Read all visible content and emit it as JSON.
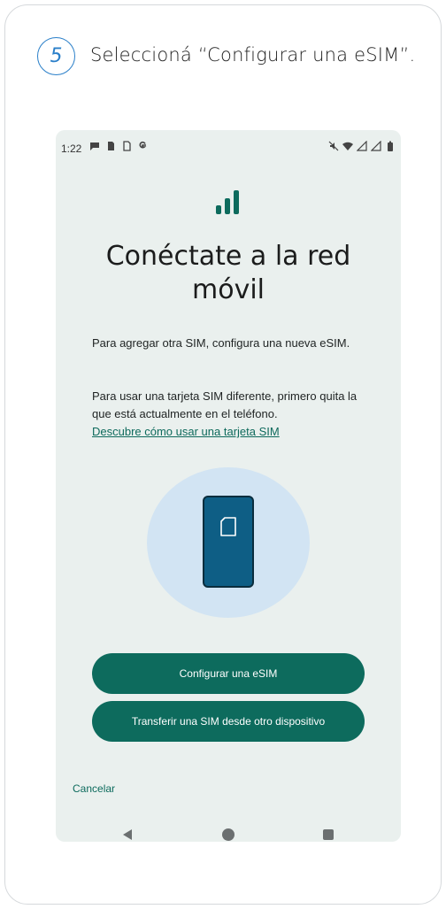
{
  "step": {
    "number": "5",
    "instruction": "Seleccioná “Configurar una eSIM”."
  },
  "status_bar": {
    "time": "1:22",
    "left_icons": [
      "chat-icon",
      "sim-icon",
      "file-icon",
      "google-icon"
    ],
    "right_icons": [
      "mute-icon",
      "wifi-icon",
      "signal-icon",
      "signal-icon",
      "battery-icon"
    ]
  },
  "screen": {
    "title_line1": "Conéctate a la red",
    "title_line2": "móvil",
    "paragraph1": "Para agregar otra SIM, configura una nueva eSIM.",
    "paragraph2": "Para usar una tarjeta SIM diferente, primero quita la que está actualmente en el teléfono.",
    "link": "Descubre cómo usar una tarjeta SIM",
    "primary_button": "Configurar una eSIM",
    "secondary_button": "Transferir una SIM desde otro dispositivo",
    "cancel": "Cancelar"
  },
  "colors": {
    "accent": "#0d6b5d",
    "step_blue": "#2a7fc9",
    "screen_bg": "#eaf0ee",
    "illustration_circle": "#d2e4f3",
    "illustration_phone": "#0e5e85"
  }
}
